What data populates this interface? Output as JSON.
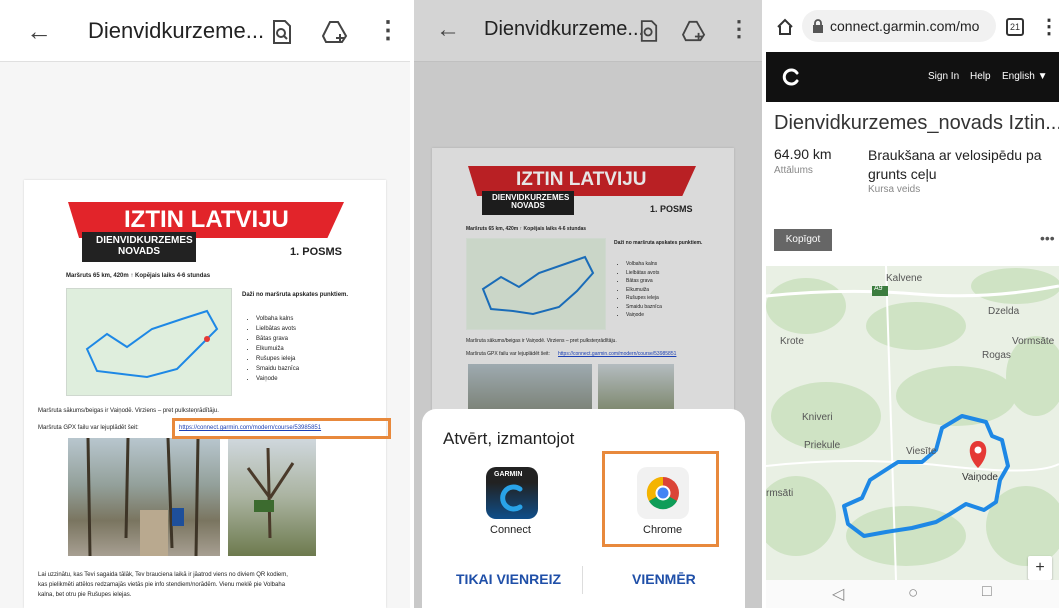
{
  "pdf_viewer": {
    "title": "Dienvidkurzeme...",
    "doc": {
      "banner": "IZTIN LATVIJU",
      "region": "DIENVIDKURZEMES NOVADS",
      "posms": "1. POSMS",
      "route_info": "Maršruts 65 km, 420m ↑ Kopējais laiks 4-6 stundas",
      "points_heading": "Daži no maršruta apskates punktiem.",
      "points": [
        "Volbaha kalns",
        "Lielbātas avots",
        "Bātas grava",
        "Elkumuiža",
        "Rušupes ieleja",
        "Smaidu baznīca",
        "Vaiņode"
      ],
      "start_text": "Maršruta sākums/beigas ir Vaiņodē. Virziens – pret pulksteņrādītāju.",
      "gpx_text": "Maršruta GPX failu var lejuplādēt šeit:",
      "gpx_link": "https://connect.garmin.com/modern/course/53985851",
      "footer_text_1": "Lai uzzinātu, kas Tevi sagaida tālāk, Tev brauciena laikā ir jāatrod viens no diviem QR kodiem,",
      "footer_text_2": "kas pielikmēti attēlos redzamajās vietās pie info stendiem/norādēm. Vienu meklē pie Volbaha",
      "footer_text_3": "kalna, bet otru pie Rušupes ielejas."
    }
  },
  "open_with": {
    "title": "Atvērt, izmantojot",
    "apps": [
      {
        "label": "Connect",
        "brand": "GARMIN"
      },
      {
        "label": "Chrome"
      }
    ],
    "once": "TIKAI VIENREIZ",
    "always": "VIENMĒR"
  },
  "browser": {
    "url": "connect.garmin.com/mo",
    "tabs": "21",
    "nav": {
      "signin": "Sign In",
      "help": "Help",
      "lang": "English ▼"
    },
    "course_title": "Dienvidkurzemes_novads Iztin...",
    "distance_value": "64.90 km",
    "distance_label": "Attālums",
    "type_value": "Braukšana ar velosipēdu pa grunts ceļu",
    "type_label": "Kursa veids",
    "share": "Kopīgot",
    "map_labels": [
      "Kalvene",
      "A9",
      "Dzelda",
      "Krote",
      "Vormsāte",
      "Rogas",
      "Kniveri",
      "Priekule",
      "Vaiņode",
      "rmsāti",
      "Viesīte"
    ],
    "zoom_in": "+"
  },
  "colors": {
    "accent_orange": "#e8893c",
    "banner_red": "#e2242a",
    "route_blue": "#1e88e5",
    "pin_red": "#e53935"
  }
}
